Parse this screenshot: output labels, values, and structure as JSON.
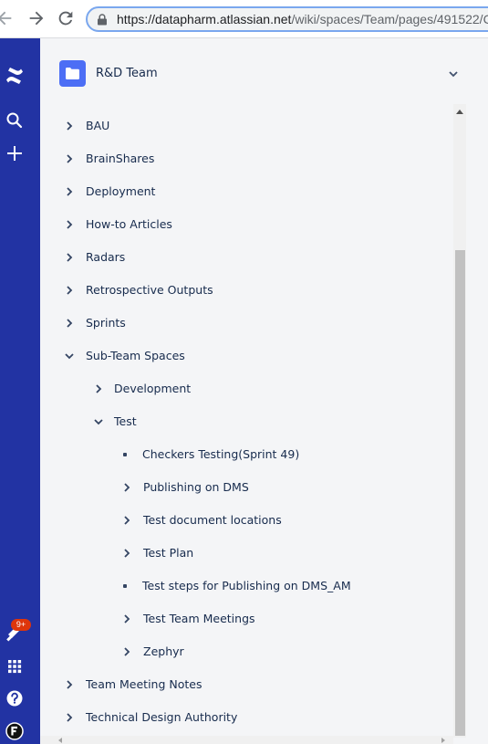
{
  "browser": {
    "url_host": "https://datapharm.atlassian.net",
    "url_path": "/wiki/spaces/Team/pages/491522/C"
  },
  "rail": {
    "icons": [
      "confluence-logo-icon",
      "search-icon",
      "plus-icon",
      "notifications-icon",
      "app-switcher-icon",
      "help-icon",
      "profile-icon"
    ],
    "notification_badge": "9+",
    "badge_color": "#de350b",
    "rail_color": "#2233a3"
  },
  "space": {
    "name": "R&D Team",
    "avatar_color": "#4c6ef5"
  },
  "tree": {
    "items": [
      {
        "label": "BAU",
        "state": "collapsed"
      },
      {
        "label": "BrainShares",
        "state": "collapsed"
      },
      {
        "label": "Deployment",
        "state": "collapsed"
      },
      {
        "label": "How-to Articles",
        "state": "collapsed"
      },
      {
        "label": "Radars",
        "state": "collapsed"
      },
      {
        "label": "Retrospective Outputs",
        "state": "collapsed"
      },
      {
        "label": "Sprints",
        "state": "collapsed"
      },
      {
        "label": "Sub-Team Spaces",
        "state": "expanded"
      },
      {
        "label": "Development",
        "state": "collapsed"
      },
      {
        "label": "Test",
        "state": "expanded"
      },
      {
        "label": "Checkers Testing(Sprint 49)",
        "state": "leaf"
      },
      {
        "label": "Publishing on DMS",
        "state": "collapsed"
      },
      {
        "label": "Test document locations",
        "state": "collapsed"
      },
      {
        "label": "Test Plan",
        "state": "collapsed"
      },
      {
        "label": "Test steps for Publishing on DMS_AM",
        "state": "leaf"
      },
      {
        "label": "Test Team Meetings",
        "state": "collapsed"
      },
      {
        "label": "Zephyr",
        "state": "collapsed"
      },
      {
        "label": "Team Meeting Notes",
        "state": "collapsed"
      },
      {
        "label": "Technical Design Authority",
        "state": "collapsed"
      }
    ]
  }
}
